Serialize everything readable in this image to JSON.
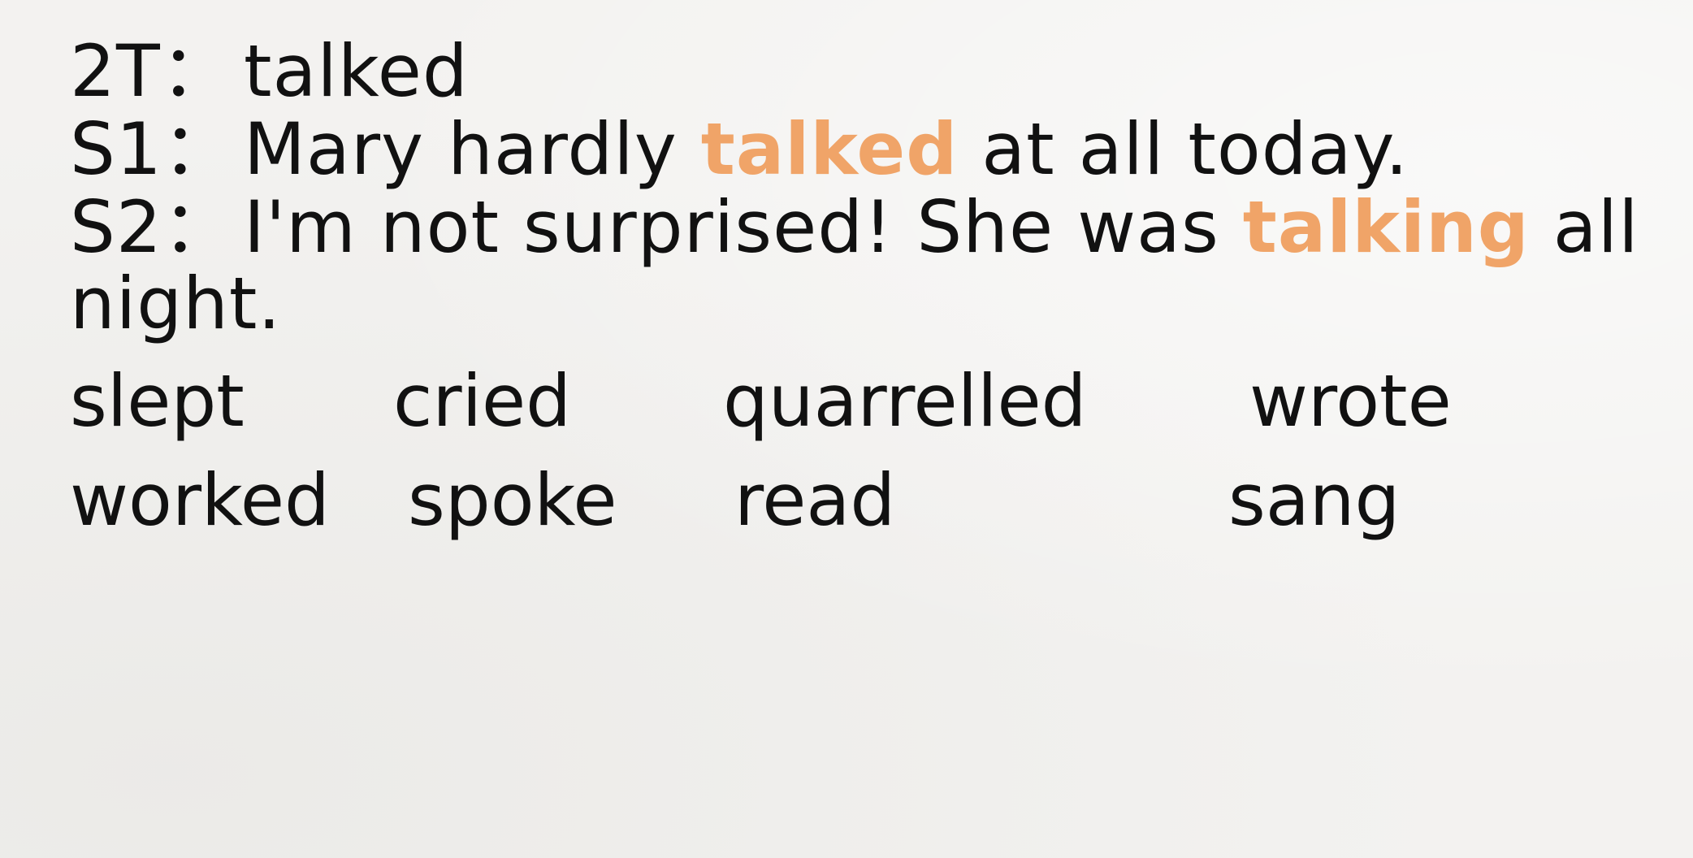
{
  "dialogue": {
    "line1": {
      "speaker": "2T：",
      "text": "talked"
    },
    "line2": {
      "speaker": "S1：",
      "before": "Mary hardly ",
      "highlight": "talked",
      "after": " at all today."
    },
    "line3": {
      "speaker": "S2：",
      "before": "I'm not surprised! She was ",
      "highlight": "talking",
      "after": " all"
    },
    "line4": {
      "text": "night."
    }
  },
  "word_bank": {
    "row1": [
      "slept",
      "cried",
      "quarrelled",
      "wrote"
    ],
    "row2": [
      "worked",
      "spoke",
      "read",
      "sang"
    ]
  },
  "colors": {
    "highlight": "#f0a468",
    "text": "#111111",
    "background": "#f3f2f0"
  }
}
